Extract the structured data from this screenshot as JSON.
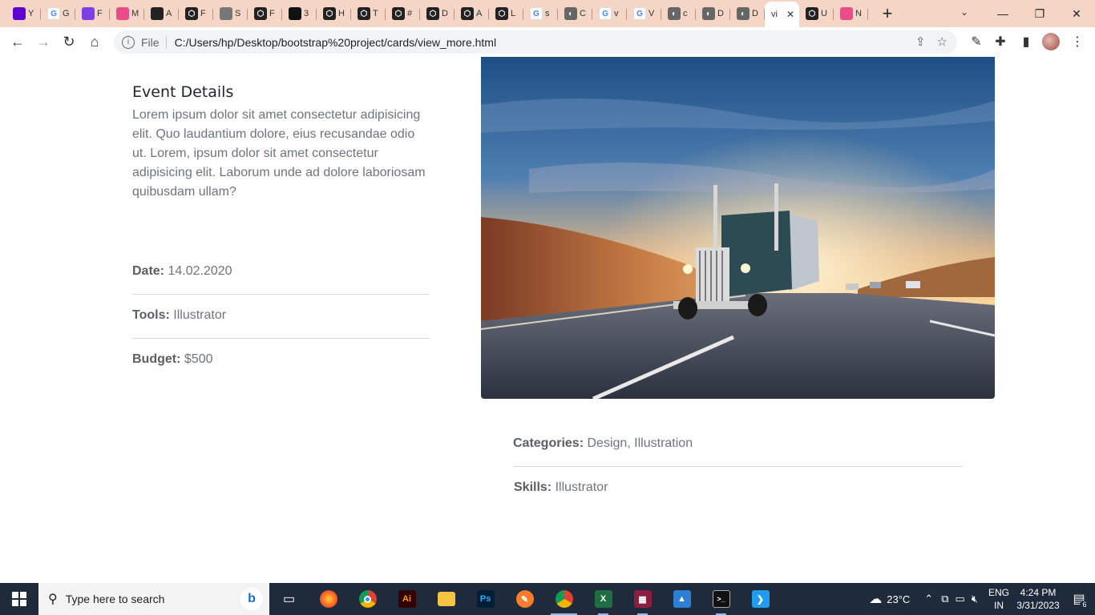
{
  "browser": {
    "tabs": [
      {
        "label": "Y",
        "icon": "yahoo-icon",
        "color": "#5f01d1"
      },
      {
        "label": "G",
        "icon": "google-icon",
        "color": "#ffffff"
      },
      {
        "label": "F",
        "icon": "figma-icon",
        "color": "#7b3fe4"
      },
      {
        "label": "M",
        "icon": "dribbble-icon",
        "color": "#ea4c89"
      },
      {
        "label": "A",
        "icon": "robot-icon",
        "color": "#222222"
      },
      {
        "label": "F",
        "icon": "codepen-icon",
        "color": "#222222"
      },
      {
        "label": "S",
        "icon": "spiral-icon",
        "color": "#777777"
      },
      {
        "label": "F",
        "icon": "codepen-icon",
        "color": "#222222"
      },
      {
        "label": "3",
        "icon": "f-logo-icon",
        "color": "#111111"
      },
      {
        "label": "H",
        "icon": "codepen-icon",
        "color": "#222222"
      },
      {
        "label": "T",
        "icon": "codepen-icon",
        "color": "#222222"
      },
      {
        "label": "#",
        "icon": "codepen-icon",
        "color": "#222222"
      },
      {
        "label": "D",
        "icon": "codepen-icon",
        "color": "#222222"
      },
      {
        "label": "A",
        "icon": "codepen-icon",
        "color": "#222222"
      },
      {
        "label": "L",
        "icon": "codepen-icon",
        "color": "#222222"
      },
      {
        "label": "s",
        "icon": "google-icon",
        "color": "#ffffff"
      },
      {
        "label": "C",
        "icon": "globe-icon",
        "color": "#666666"
      },
      {
        "label": "v",
        "icon": "google-icon",
        "color": "#ffffff"
      },
      {
        "label": "V",
        "icon": "google-icon",
        "color": "#ffffff"
      },
      {
        "label": "c",
        "icon": "globe-icon",
        "color": "#666666"
      },
      {
        "label": "D",
        "icon": "globe-icon",
        "color": "#666666"
      },
      {
        "label": "D",
        "icon": "globe-icon",
        "color": "#666666"
      },
      {
        "label": "vi",
        "icon": "",
        "color": "",
        "active": true
      },
      {
        "label": "U",
        "icon": "codepen-icon",
        "color": "#222222"
      },
      {
        "label": "N",
        "icon": "dribbble-icon",
        "color": "#ea4c89"
      }
    ],
    "omnibox": {
      "scheme_label": "File",
      "url": "C:/Users/hp/Desktop/bootstrap%20project/cards/view_more.html"
    }
  },
  "page": {
    "event": {
      "title": "Event Details",
      "description": "Lorem ipsum dolor sit amet consectetur adipisicing elit. Quo laudantium dolore, eius recusandae odio ut. Lorem, ipsum dolor sit amet consectetur adipisicing elit. Laborum unde ad dolore laboriosam quibusdam ullam?"
    },
    "meta_left": [
      {
        "label": "Date:",
        "value": "14.02.2020"
      },
      {
        "label": "Tools:",
        "value": "Illustrator"
      },
      {
        "label": "Budget:",
        "value": "$500"
      }
    ],
    "meta_right": [
      {
        "label": "Categories:",
        "value": "Design, Illustration"
      },
      {
        "label": "Skills:",
        "value": "Illustrator"
      }
    ],
    "hero_image": "truck-on-highway-sunset"
  },
  "taskbar": {
    "search_placeholder": "Type here to search",
    "weather": "23°C",
    "language": "ENG",
    "region": "IN",
    "time": "4:24 PM",
    "date": "3/31/2023",
    "notifications": "6"
  }
}
